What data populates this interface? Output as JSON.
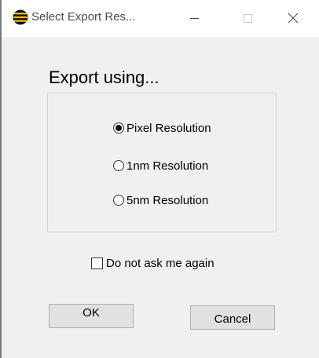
{
  "window": {
    "title": "Select Export Res...",
    "app_icon": "app-logo-icon",
    "controls": {
      "minimize": "minimize-icon",
      "maximize": "maximize-icon",
      "close": "close-icon"
    }
  },
  "dialog": {
    "heading": "Export using...",
    "options": [
      {
        "label": "Pixel Resolution",
        "selected": true
      },
      {
        "label": "1nm Resolution",
        "selected": false
      },
      {
        "label": "5nm Resolution",
        "selected": false
      }
    ],
    "dont_ask": {
      "label": "Do not ask me again",
      "checked": false
    },
    "buttons": {
      "ok": "OK",
      "cancel": "Cancel"
    }
  }
}
